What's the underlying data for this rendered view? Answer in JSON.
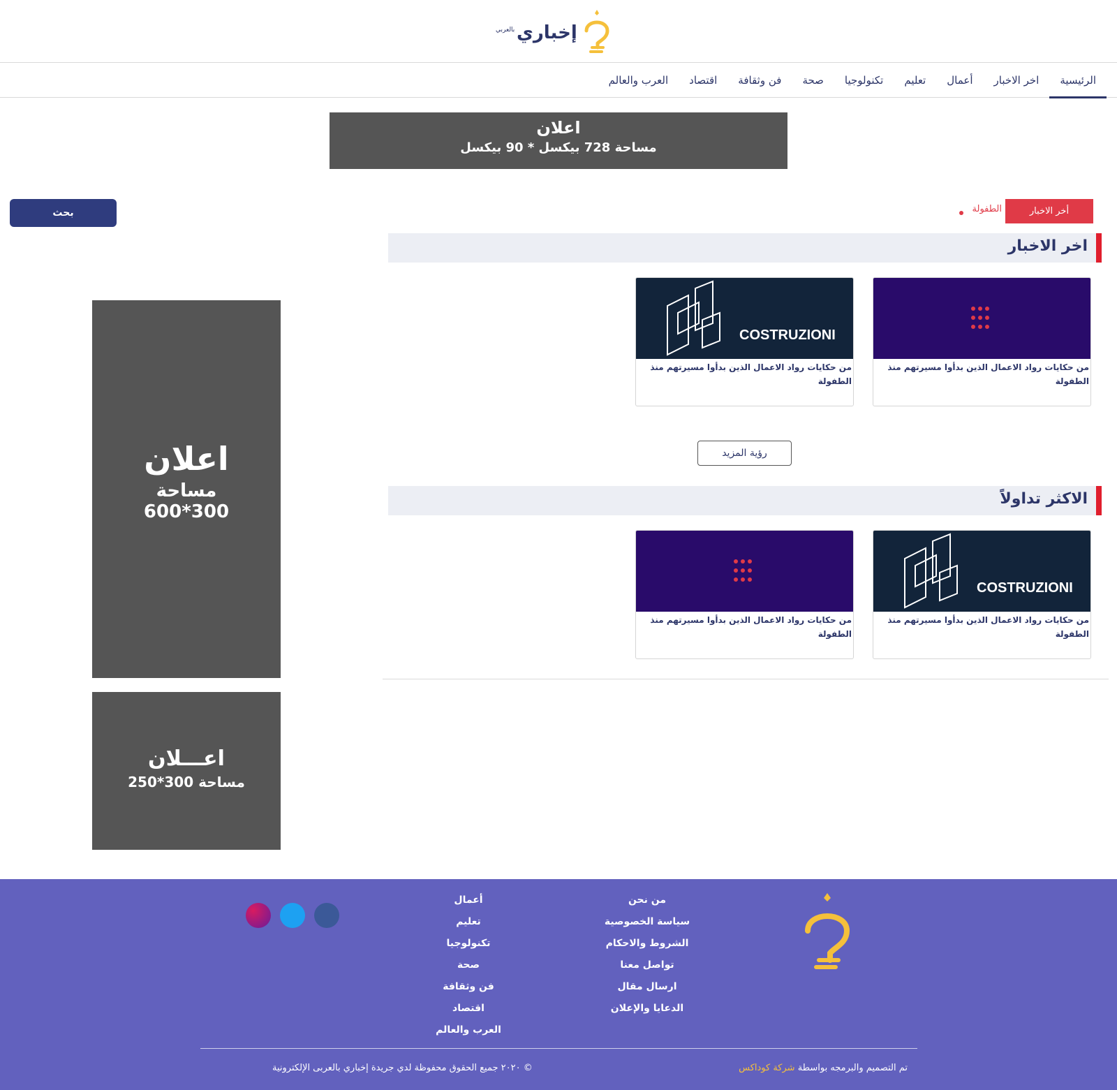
{
  "header": {
    "logo_text": "إخباري",
    "logo_sub": "بالعربي"
  },
  "nav": {
    "items": [
      "الرئيسية",
      "اخر الاخبار",
      "أعمال",
      "تعليم",
      "تكنولوجيا",
      "صحة",
      "فن وثقافة",
      "اقتصاد",
      "العرب والعالم"
    ]
  },
  "ad_top": {
    "title": "اعلان",
    "size": "مساحة 728 بيكسل * 90 بيكسل"
  },
  "search": {
    "button_label": "بحث"
  },
  "ticker": {
    "label": "أخر الاخبار",
    "item": "الطفولة"
  },
  "sections": {
    "latest": {
      "title": "اخر الاخبار",
      "cards": [
        {
          "image_brand": "COSTRUZIONI",
          "text": "من حكايات رواد الاعمال الذين بدأوا مسيرتهم منذ الطفولة"
        },
        {
          "image_brand": "",
          "text": "من حكايات رواد الاعمال الذين بدأوا مسيرتهم منذ الطفولة"
        }
      ],
      "more_label": "رؤية المزيد"
    },
    "trending": {
      "title": "الاكثر تداولاً",
      "cards": [
        {
          "image_brand": "",
          "text": "من حكايات رواد الاعمال الذين بدأوا مسيرتهم منذ الطفولة"
        },
        {
          "image_brand": "COSTRUZIONI",
          "text": "من حكايات رواد الاعمال الذين بدأوا مسيرتهم منذ الطفولة"
        }
      ]
    }
  },
  "ad_tall": {
    "title": "اعلان",
    "line2": "مساحة",
    "line3": "600*300"
  },
  "ad_med": {
    "title": "اعـــلان",
    "line2": "مساحة 300*250"
  },
  "footer": {
    "col1": [
      "من نحن",
      "سياسة الخصوصية",
      "الشروط والاحكام",
      "تواصل معنا",
      "ارسال مقال",
      "الدعايا والإعلان"
    ],
    "col2": [
      "أعمال",
      "تعليم",
      "تكنولوجيا",
      "صحة",
      "فن وثقافة",
      "اقتصاد",
      "العرب والعالم"
    ],
    "credit_prefix": "تم التصميم والبرمجه بواسطة",
    "credit_company": "شركة كوداكس",
    "copyright": "© ٢٠٢٠ جميع الحقوق محفوظة لدي جريدة إخباري بالعربى الإلكترونية"
  },
  "colors": {
    "brand_navy": "#2c3568",
    "accent_red": "#e01e2d",
    "footer_bg": "#6261be",
    "logo_yellow": "#f5c03b",
    "ad_gray": "#555555"
  }
}
